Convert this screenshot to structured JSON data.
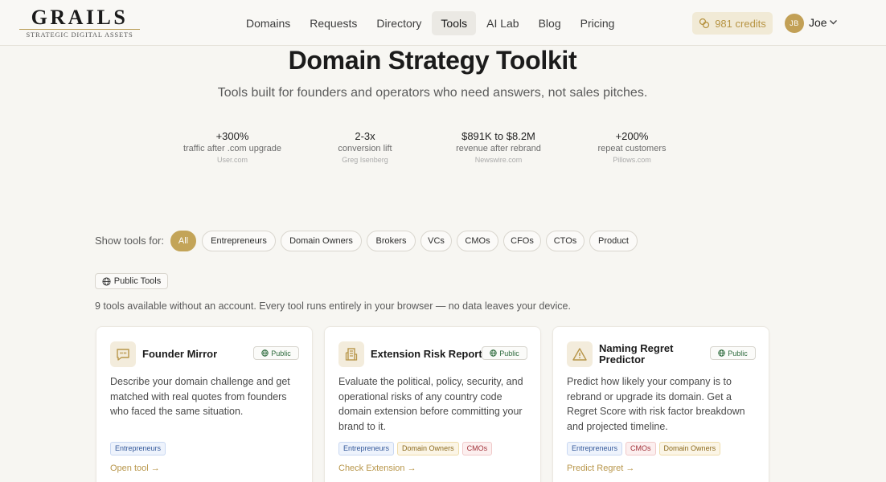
{
  "logo": {
    "word": "GRAILS",
    "tagline": "STRATEGIC DIGITAL ASSETS"
  },
  "nav": {
    "links": [
      {
        "label": "Domains"
      },
      {
        "label": "Requests"
      },
      {
        "label": "Directory"
      },
      {
        "label": "Tools",
        "active": true
      },
      {
        "label": "AI Lab"
      },
      {
        "label": "Blog"
      },
      {
        "label": "Pricing"
      }
    ],
    "credits": "981 credits",
    "user_initials": "JB",
    "user_name": "Joe"
  },
  "hero": {
    "title": "Domain Strategy Toolkit",
    "subtitle": "Tools built for founders and operators who need answers, not sales pitches."
  },
  "stats": [
    {
      "value": "+300%",
      "desc": "traffic after .com upgrade",
      "source": "User.com"
    },
    {
      "value": "2-3x",
      "desc": "conversion lift",
      "source": "Greg Isenberg"
    },
    {
      "value": "$891K to $8.2M",
      "desc": "revenue after rebrand",
      "source": "Newswire.com"
    },
    {
      "value": "+200%",
      "desc": "repeat customers",
      "source": "Pillows.com"
    }
  ],
  "filters": {
    "label": "Show tools for:",
    "options": [
      "All",
      "Entrepreneurs",
      "Domain Owners",
      "Brokers",
      "VCs",
      "CMOs",
      "CFOs",
      "CTOs",
      "Product"
    ],
    "selected": "All"
  },
  "section": {
    "badge": "Public Tools",
    "note": "9 tools available without an account. Every tool runs entirely in your browser — no data leaves your device."
  },
  "cards": [
    {
      "icon": "chat-quote-icon",
      "title_lines": [
        "Founder Mirror"
      ],
      "badge": "Public",
      "description": "Describe your domain challenge and get matched with real quotes from founders who faced the same situation.",
      "tags": [
        {
          "label": "Entrepreneurs",
          "kind": "ent"
        }
      ],
      "link": "Open tool →"
    },
    {
      "icon": "report-building-icon",
      "title_lines": [
        "Extension Risk Report"
      ],
      "badge": "Public",
      "description": "Evaluate the political, policy, security, and operational risks of any country code domain extension before committing your brand to it.",
      "tags": [
        {
          "label": "Entrepreneurs",
          "kind": "ent"
        },
        {
          "label": "Domain Owners",
          "kind": "dom"
        },
        {
          "label": "CMOs",
          "kind": "cmo"
        }
      ],
      "link": "Check Extension →"
    },
    {
      "icon": "warning-triangle-icon",
      "title_lines": [
        "Naming Regret",
        "Predictor"
      ],
      "badge": "Public",
      "description": "Predict how likely your company is to rebrand or upgrade its domain. Get a Regret Score with risk factor breakdown and projected timeline.",
      "tags": [
        {
          "label": "Entrepreneurs",
          "kind": "ent"
        },
        {
          "label": "CMOs",
          "kind": "cmo"
        },
        {
          "label": "Domain Owners",
          "kind": "dom"
        }
      ],
      "link": "Predict Regret →"
    }
  ],
  "colors": {
    "accent": "#c3a458",
    "link": "#b8964a",
    "public_green": "#2e6b3d"
  }
}
